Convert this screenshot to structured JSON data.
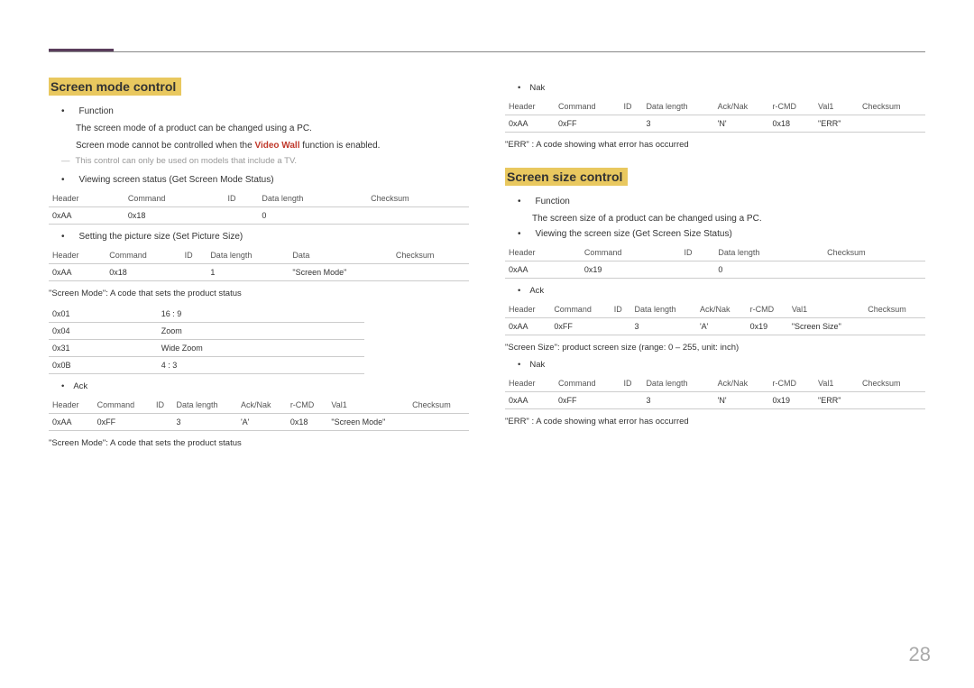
{
  "pageNumber": "28",
  "left": {
    "title": "Screen mode control",
    "functionLabel": "Function",
    "functionLine1": "The screen mode of a product can be changed using a PC.",
    "functionPre": "Screen mode cannot be controlled when the ",
    "functionBold": "Video Wall",
    "functionPost": " function is enabled.",
    "note": "This control can only be used on models that include a TV.",
    "viewingBullet": "Viewing screen status (Get Screen Mode Status)",
    "t1": {
      "h": [
        "Header",
        "Command",
        "ID",
        "Data length",
        "Checksum"
      ],
      "r": [
        "0xAA",
        "0x18",
        "",
        "0",
        ""
      ]
    },
    "settingBullet": "Setting the picture size (Set Picture Size)",
    "t2": {
      "h": [
        "Header",
        "Command",
        "ID",
        "Data length",
        "Data",
        "Checksum"
      ],
      "r": [
        "0xAA",
        "0x18",
        "",
        "1",
        "\"Screen Mode\"",
        ""
      ]
    },
    "codeLine": "\"Screen Mode\": A code that sets the product status",
    "t3": {
      "rows": [
        [
          "0x01",
          "16 : 9"
        ],
        [
          "0x04",
          "Zoom"
        ],
        [
          "0x31",
          "Wide Zoom"
        ],
        [
          "0x0B",
          "4 : 3"
        ]
      ]
    },
    "ackLabel": "Ack",
    "t4": {
      "h": [
        "Header",
        "Command",
        "ID",
        "Data length",
        "Ack/Nak",
        "r-CMD",
        "Val1",
        "Checksum"
      ],
      "r": [
        "0xAA",
        "0xFF",
        "",
        "3",
        "'A'",
        "0x18",
        "\"Screen Mode\"",
        ""
      ]
    },
    "codeLine2": "\"Screen Mode\": A code that sets the product status"
  },
  "right": {
    "nakLabel": "Nak",
    "t1": {
      "h": [
        "Header",
        "Command",
        "ID",
        "Data length",
        "Ack/Nak",
        "r-CMD",
        "Val1",
        "Checksum"
      ],
      "r": [
        "0xAA",
        "0xFF",
        "",
        "3",
        "'N'",
        "0x18",
        "\"ERR\"",
        ""
      ]
    },
    "errLine": "\"ERR\" : A code showing what error has occurred",
    "title": "Screen size control",
    "functionLabel": "Function",
    "functionLine1": "The screen size of a product can be changed using a PC.",
    "viewingBullet": "Viewing the screen size (Get Screen Size Status)",
    "t2": {
      "h": [
        "Header",
        "Command",
        "ID",
        "Data length",
        "Checksum"
      ],
      "r": [
        "0xAA",
        "0x19",
        "",
        "0",
        ""
      ]
    },
    "ackLabel": "Ack",
    "t3": {
      "h": [
        "Header",
        "Command",
        "ID",
        "Data length",
        "Ack/Nak",
        "r-CMD",
        "Val1",
        "Checksum"
      ],
      "r": [
        "0xAA",
        "0xFF",
        "",
        "3",
        "'A'",
        "0x19",
        "\"Screen Size\"",
        ""
      ]
    },
    "sizeLine": "\"Screen Size\": product screen size (range: 0 – 255, unit: inch)",
    "nakLabel2": "Nak",
    "t4": {
      "h": [
        "Header",
        "Command",
        "ID",
        "Data length",
        "Ack/Nak",
        "r-CMD",
        "Val1",
        "Checksum"
      ],
      "r": [
        "0xAA",
        "0xFF",
        "",
        "3",
        "'N'",
        "0x19",
        "\"ERR\"",
        ""
      ]
    },
    "errLine2": "\"ERR\" : A code showing what error has occurred"
  }
}
